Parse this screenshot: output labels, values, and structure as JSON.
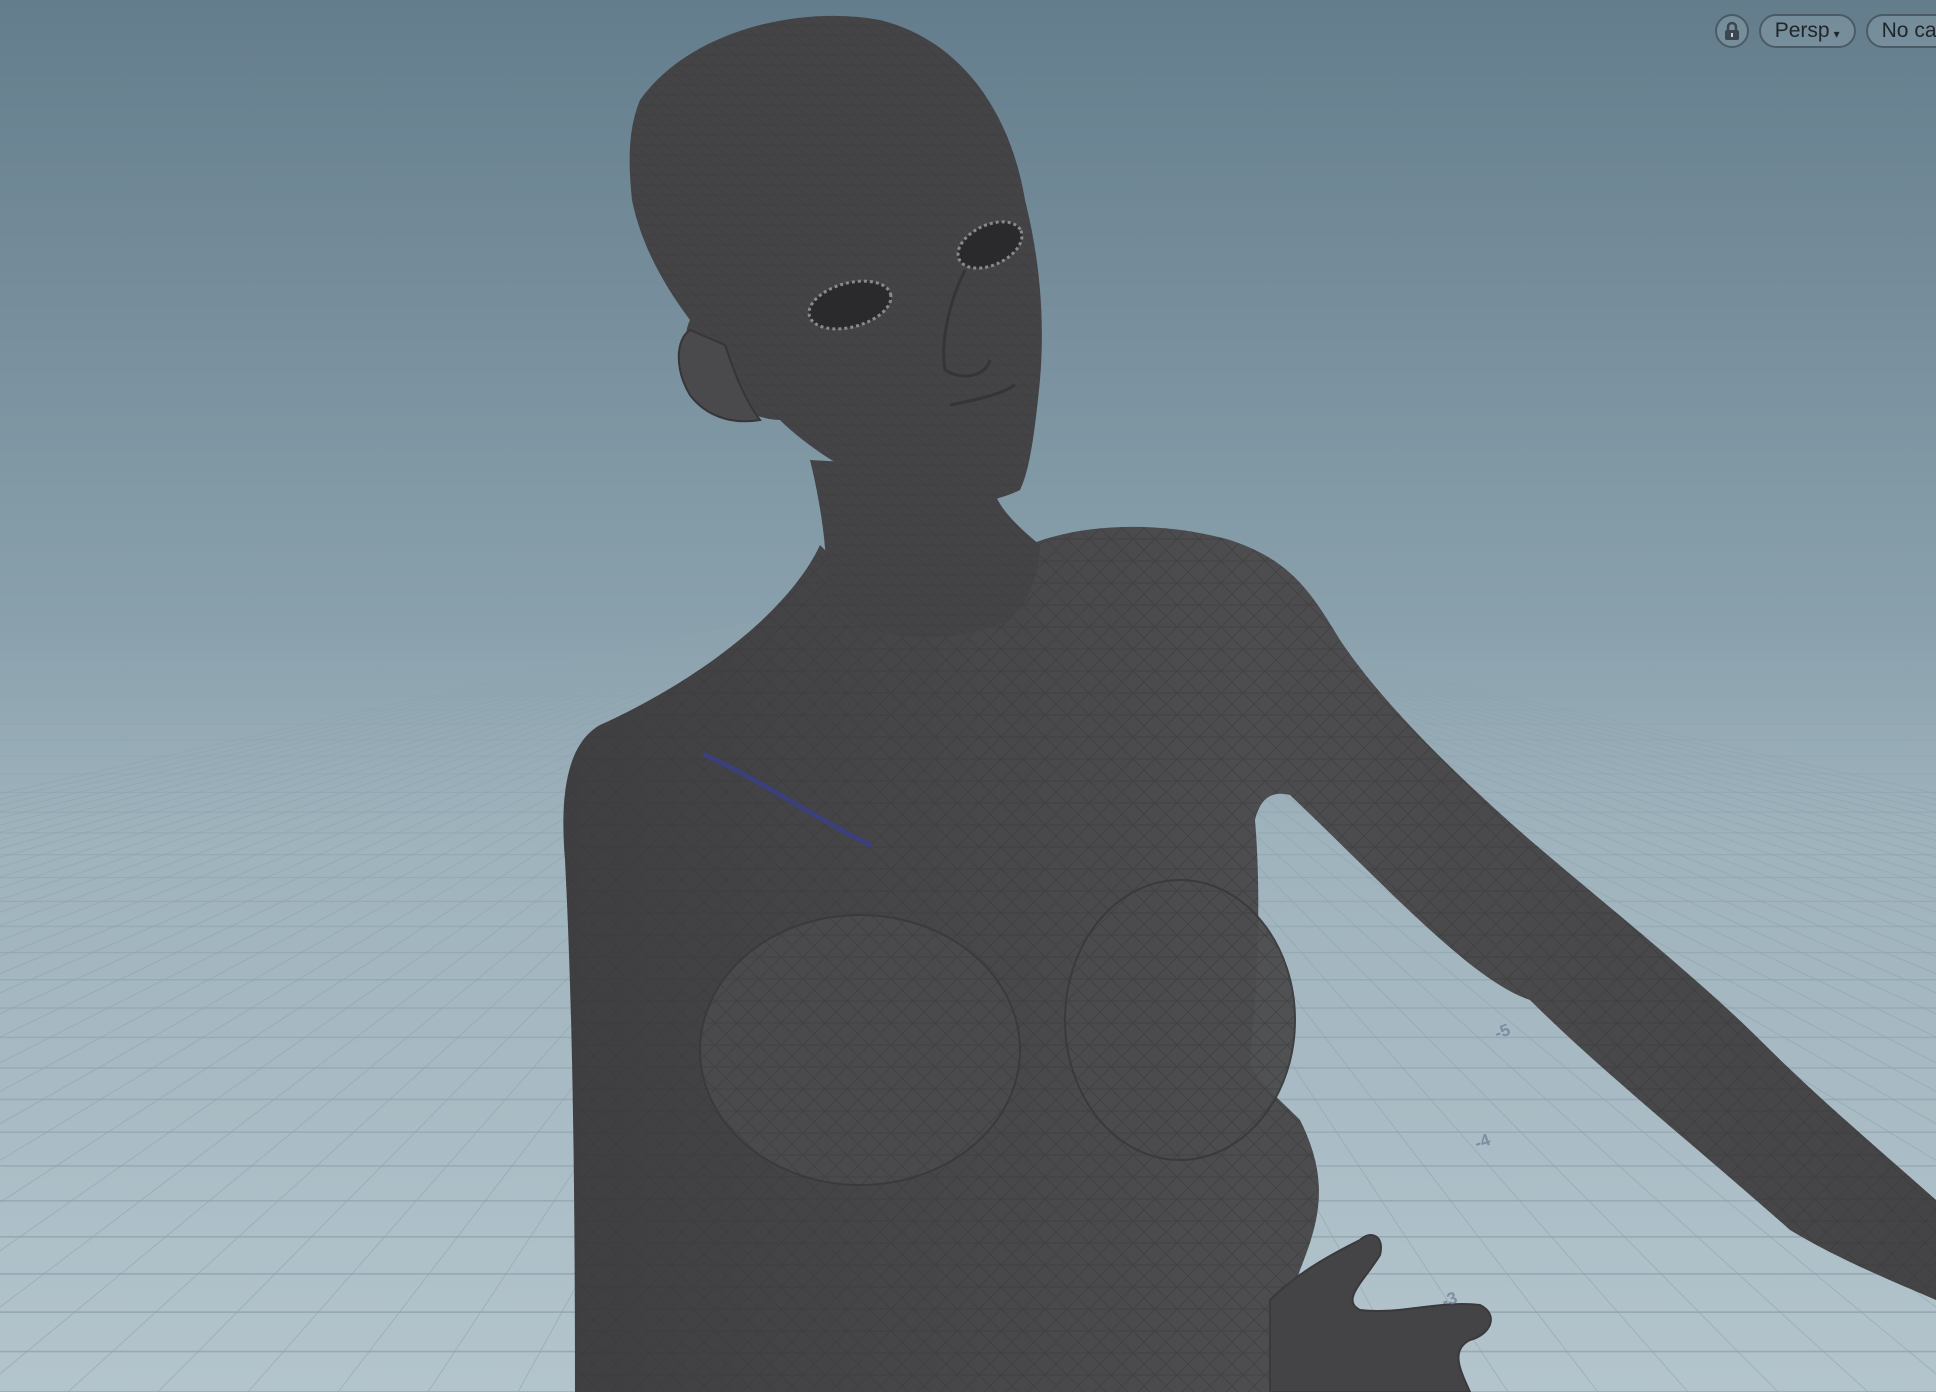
{
  "viewport": {
    "camera_mode": "Persp",
    "camera_mode_caret": "▾",
    "camera_select": "No cam"
  },
  "icons": {
    "lock": "lock-icon",
    "camera_mode_dropdown": "chevron-down-icon"
  },
  "grid": {
    "labels": [
      "-5",
      "-4",
      "-3"
    ]
  },
  "colors": {
    "background_top": "#667f8d",
    "background_horizon": "#93a9b4",
    "ground": "#a9bdc6",
    "grid_line": "#8fa3ad",
    "mesh": "#4a4a4c",
    "wire": "#3a3a3c",
    "selection_stroke": "#3b3f7a"
  }
}
